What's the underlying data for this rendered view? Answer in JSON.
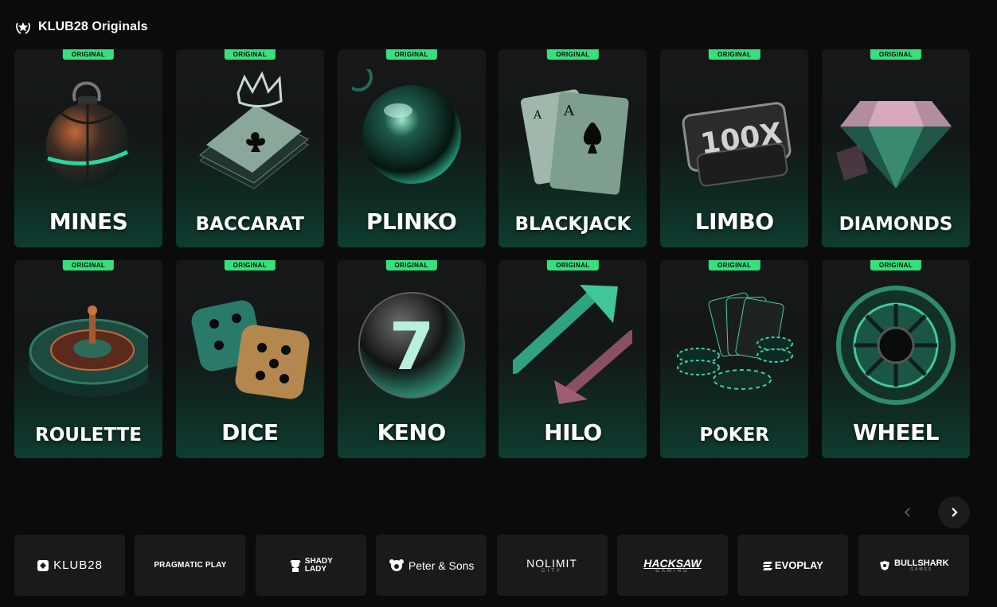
{
  "section": {
    "title": "KLUB28 Originals",
    "icon": "star-laurel-icon"
  },
  "badge_label": "ORIGINAL",
  "games": [
    {
      "name": "MINES",
      "icon": "mines-bomb-icon"
    },
    {
      "name": "BACCARAT",
      "icon": "crown-cards-icon"
    },
    {
      "name": "PLINKO",
      "icon": "plinko-ball-icon"
    },
    {
      "name": "BLACKJACK",
      "icon": "ace-cards-icon"
    },
    {
      "name": "LIMBO",
      "icon": "multiplier-plate-icon"
    },
    {
      "name": "DIAMONDS",
      "icon": "diamond-icon"
    },
    {
      "name": "ROULETTE",
      "icon": "roulette-wheel-icon"
    },
    {
      "name": "DICE",
      "icon": "dice-icon"
    },
    {
      "name": "KENO",
      "icon": "keno-ball-icon"
    },
    {
      "name": "HILO",
      "icon": "up-down-arrows-icon"
    },
    {
      "name": "POKER",
      "icon": "poker-chips-icon"
    },
    {
      "name": "WHEEL",
      "icon": "fortune-wheel-icon"
    }
  ],
  "limbo_art_text": "100X",
  "keno_art_text": "7",
  "carousel": {
    "prev_icon": "chevron-left-icon",
    "next_icon": "chevron-right-icon"
  },
  "providers": [
    {
      "label": "KLUB28",
      "icon": "klub28-logo"
    },
    {
      "label": "PRAGMATIC PLAY",
      "icon": "pragmatic-play-logo"
    },
    {
      "label": "SHADY LADY",
      "icon": "shady-lady-logo"
    },
    {
      "label": "Peter & Sons",
      "icon": "peter-sons-logo"
    },
    {
      "label": "NOLIMIT",
      "sub": "CITY",
      "icon": "nolimit-city-logo"
    },
    {
      "label": "HACKSAW",
      "sub": "GAMING",
      "icon": "hacksaw-gaming-logo"
    },
    {
      "label": "EVOPLAY",
      "icon": "evoplay-logo"
    },
    {
      "label": "BULLSHARK",
      "sub": "GAMES",
      "icon": "bullshark-games-logo"
    }
  ],
  "colors": {
    "accent": "#36e07c",
    "background": "#0b0b0c",
    "card_bottom": "#0f3d31",
    "tile": "#1a1a1c"
  }
}
